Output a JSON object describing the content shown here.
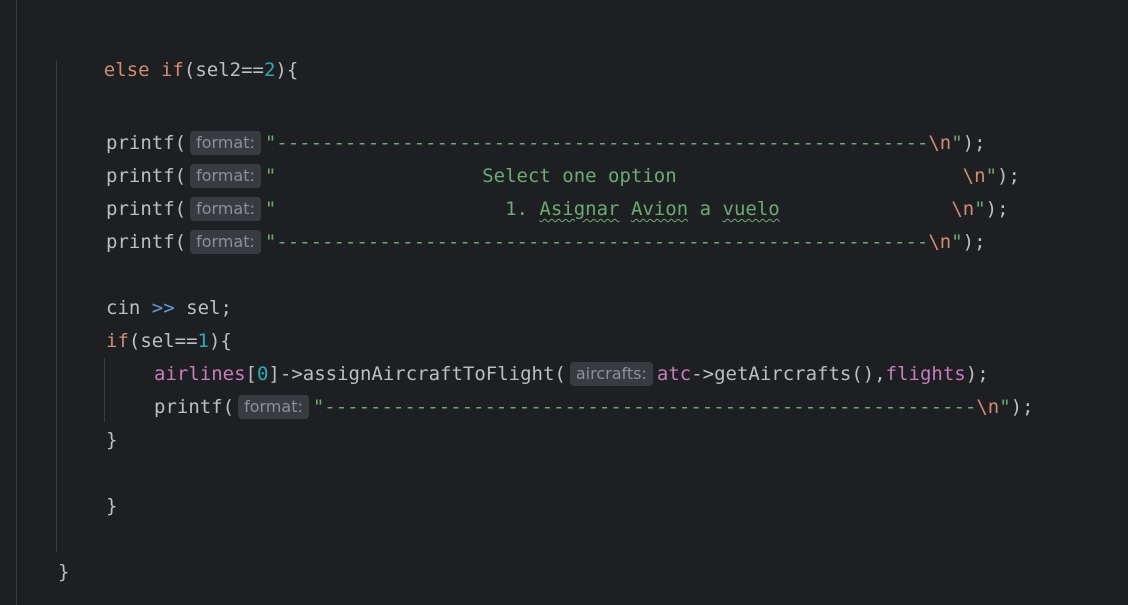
{
  "code": {
    "l1": {
      "else": "else",
      "if": "if",
      "open": "(sel2==",
      "num": "2",
      "close": "){"
    },
    "printf": "printf(",
    "format_hint": "format:",
    "aircrafts_hint": "aircrafts:",
    "dash_line_1": "\"---------------------------------------------------------",
    "esc_n": "\\n",
    "quote_end": "\");",
    "select_prefix": "\"",
    "select_text": "                  Select one option",
    "select_pad": "                         ",
    "option_prefix": "\"",
    "option_indent": "                    1. ",
    "option_word1": "Asignar",
    "option_word2": "Avion",
    "option_a": "a",
    "option_word3": "vuelo",
    "option_pad": "               ",
    "cin": "cin",
    "shift": ">>",
    "sel": "sel;",
    "if2": {
      "if": "if",
      "open": "(sel==",
      "num": "1",
      "close": "){"
    },
    "airlines": "airlines",
    "index_open": "[",
    "index": "0",
    "index_close": "]",
    "assign_call": "->assignAircraftToFlight(",
    "atc": "atc",
    "get_call": "->getAircrafts(),",
    "flights": "flights",
    "call_end": ");",
    "dash_line_2": "\"---------------------------------------------------------",
    "close_brace": "}"
  }
}
